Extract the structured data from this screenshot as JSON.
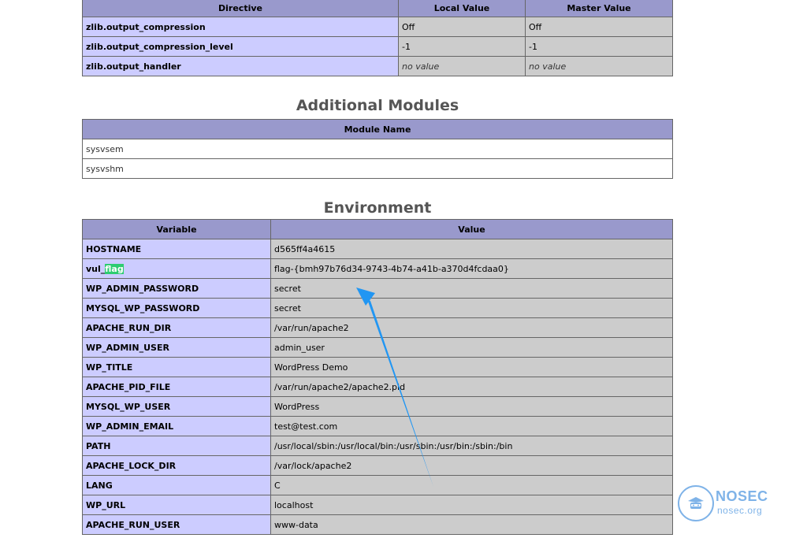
{
  "zlib_table": {
    "headers": [
      "Directive",
      "Local Value",
      "Master Value"
    ],
    "rows": [
      {
        "directive": "zlib.output_compression",
        "local": "Off",
        "master": "Off"
      },
      {
        "directive": "zlib.output_compression_level",
        "local": "-1",
        "master": "-1"
      },
      {
        "directive": "zlib.output_handler",
        "local": "no value",
        "master": "no value"
      }
    ]
  },
  "modules": {
    "title": "Additional Modules",
    "header": "Module Name",
    "items": [
      "sysvsem",
      "sysvshm"
    ]
  },
  "environment": {
    "title": "Environment",
    "headers": [
      "Variable",
      "Value"
    ],
    "flag_row": {
      "prefix": "vul_",
      "highlight": "flag",
      "value": "flag-{bmh97b76d34-9743-4b74-a41b-a370d4fcdaa0}"
    },
    "rows": [
      {
        "var": "HOSTNAME",
        "value": "d565ff4a4615"
      },
      {
        "var": "WP_ADMIN_PASSWORD",
        "value": "secret"
      },
      {
        "var": "MYSQL_WP_PASSWORD",
        "value": "secret"
      },
      {
        "var": "APACHE_RUN_DIR",
        "value": "/var/run/apache2"
      },
      {
        "var": "WP_ADMIN_USER",
        "value": "admin_user"
      },
      {
        "var": "WP_TITLE",
        "value": "WordPress Demo"
      },
      {
        "var": "APACHE_PID_FILE",
        "value": "/var/run/apache2/apache2.pid"
      },
      {
        "var": "MYSQL_WP_USER",
        "value": "WordPress"
      },
      {
        "var": "WP_ADMIN_EMAIL",
        "value": "test@test.com"
      },
      {
        "var": "PATH",
        "value": "/usr/local/sbin:/usr/local/bin:/usr/sbin:/usr/bin:/sbin:/bin"
      },
      {
        "var": "APACHE_LOCK_DIR",
        "value": "/var/lock/apache2"
      },
      {
        "var": "LANG",
        "value": "C"
      },
      {
        "var": "WP_URL",
        "value": "localhost"
      },
      {
        "var": "APACHE_RUN_USER",
        "value": "www-data"
      }
    ]
  },
  "watermark": {
    "brand": "NOSEC",
    "domain": "nosec.org",
    "icon": "nosec-mascot-icon",
    "color": "#7fb3e8"
  },
  "colors": {
    "header_bg": "#9999cc",
    "key_bg": "#ccccff",
    "value_bg": "#cccccc",
    "highlight": "#2ecc71",
    "arrow": "#2196f3"
  }
}
